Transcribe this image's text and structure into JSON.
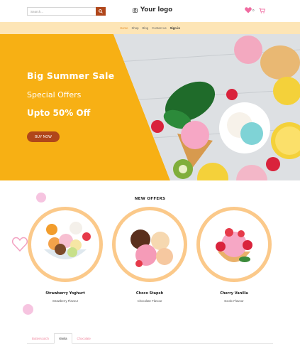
{
  "header": {
    "search": {
      "placeholder": "Search...",
      "value": ""
    },
    "logo_text": "Your logo",
    "wishlist_count": "0"
  },
  "nav": {
    "items": [
      {
        "label": "Home",
        "active": true
      },
      {
        "label": "Shop",
        "active": false
      },
      {
        "label": "Blog",
        "active": false
      },
      {
        "label": "Contact us",
        "active": false
      },
      {
        "label": "Sign in",
        "active": false
      }
    ]
  },
  "hero": {
    "title": "Big Summer Sale",
    "subtitle": "Special Offers",
    "offer": "Upto 50% Off",
    "button_label": "BUY NOW"
  },
  "offers": {
    "title": "NEW OFFERS",
    "products": [
      {
        "name": "Strawberry Yoghurt",
        "flavour": "Strawberry Flavour"
      },
      {
        "name": "Choco Stapsh",
        "flavour": "Chocolate Flavour"
      },
      {
        "name": "Cherry Vanilla",
        "flavour": "Exotic Flavour"
      }
    ]
  },
  "tabs": {
    "items": [
      {
        "label": "Butterscotch",
        "active": false
      },
      {
        "label": "Vanila",
        "active": true
      },
      {
        "label": "Chocolate",
        "active": false
      }
    ]
  },
  "colors": {
    "accent_brown": "#b0461a",
    "hero_yellow": "#f7b014",
    "nav_bg": "#fde5b6",
    "ring": "#fbc98a",
    "pink": "#f6c4e0",
    "nav_active": "#e8922b"
  },
  "icons": {
    "search": "magnifier-icon",
    "logo": "camera-icon",
    "wishlist": "heart-icon",
    "cart": "cart-icon"
  }
}
